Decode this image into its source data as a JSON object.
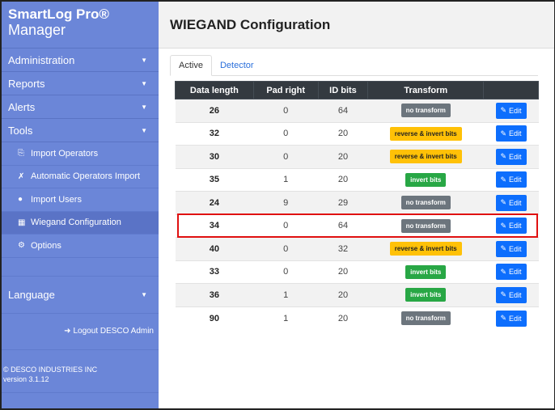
{
  "brand": {
    "line1": "SmartLog Pro®",
    "line2": "Manager"
  },
  "sidebar": {
    "items": [
      {
        "label": "Administration"
      },
      {
        "label": "Reports"
      },
      {
        "label": "Alerts"
      },
      {
        "label": "Tools"
      }
    ],
    "tools": [
      {
        "label": "Import Operators",
        "icon": "import-icon"
      },
      {
        "label": "Automatic Operators Import",
        "icon": "wrench-icon"
      },
      {
        "label": "Import Users",
        "icon": "users-icon"
      },
      {
        "label": "Wiegand Configuration",
        "icon": "card-icon"
      },
      {
        "label": "Options",
        "icon": "gear-icon"
      }
    ],
    "language": "Language",
    "logout": "Logout DESCO Admin",
    "footer": {
      "company": "© DESCO INDUSTRIES INC",
      "version": "version 3.1.12"
    }
  },
  "page": {
    "title": "WIEGAND Configuration"
  },
  "tabs": [
    {
      "label": "Active"
    },
    {
      "label": "Detector"
    }
  ],
  "table": {
    "headers": [
      "Data length",
      "Pad right",
      "ID bits",
      "Transform",
      ""
    ],
    "rows": [
      {
        "data_length": "26",
        "pad_right": "0",
        "id_bits": "64",
        "transform": "no transform",
        "edit": "Edit"
      },
      {
        "data_length": "32",
        "pad_right": "0",
        "id_bits": "20",
        "transform": "reverse & invert bits",
        "edit": "Edit"
      },
      {
        "data_length": "30",
        "pad_right": "0",
        "id_bits": "20",
        "transform": "reverse & invert bits",
        "edit": "Edit"
      },
      {
        "data_length": "35",
        "pad_right": "1",
        "id_bits": "20",
        "transform": "invert bits",
        "edit": "Edit"
      },
      {
        "data_length": "24",
        "pad_right": "9",
        "id_bits": "29",
        "transform": "no transform",
        "edit": "Edit"
      },
      {
        "data_length": "34",
        "pad_right": "0",
        "id_bits": "64",
        "transform": "no transform",
        "edit": "Edit"
      },
      {
        "data_length": "40",
        "pad_right": "0",
        "id_bits": "32",
        "transform": "reverse & invert bits",
        "edit": "Edit"
      },
      {
        "data_length": "33",
        "pad_right": "0",
        "id_bits": "20",
        "transform": "invert bits",
        "edit": "Edit"
      },
      {
        "data_length": "36",
        "pad_right": "1",
        "id_bits": "20",
        "transform": "invert bits",
        "edit": "Edit"
      },
      {
        "data_length": "90",
        "pad_right": "1",
        "id_bits": "20",
        "transform": "no transform",
        "edit": "Edit"
      }
    ]
  },
  "colors": {
    "sidebar_bg": "#6b86d8",
    "highlight": "#e01010",
    "badge_no_transform": "#6c757d",
    "badge_reverse": "#ffc107",
    "badge_invert": "#28a745",
    "edit_button": "#0d6efd"
  }
}
